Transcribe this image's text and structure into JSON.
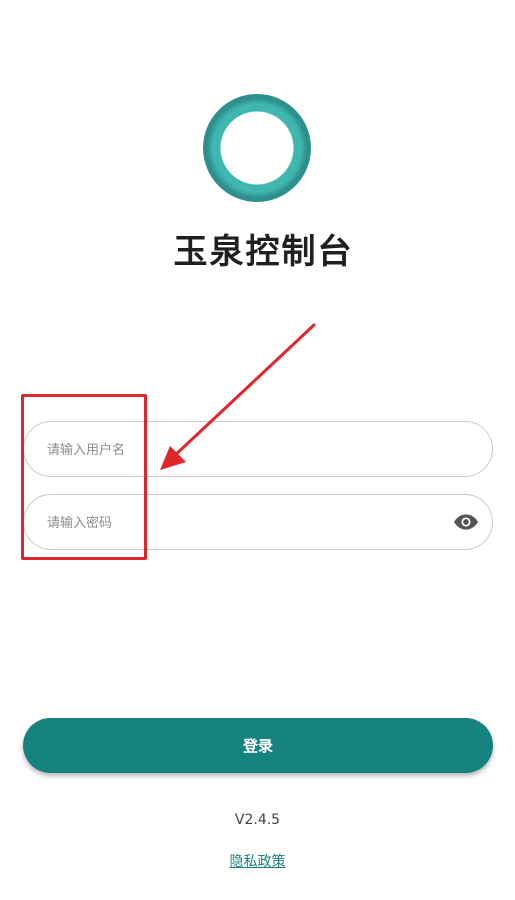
{
  "app": {
    "title": "玉泉控制台",
    "logo_icon": "ring-logo-icon"
  },
  "login_form": {
    "username_placeholder": "请输入用户名",
    "username_value": "",
    "password_placeholder": "请输入密码",
    "password_value": "",
    "toggle_visibility_icon": "eye-icon",
    "submit_label": "登录"
  },
  "footer": {
    "version": "V2.4.5",
    "privacy_link": "隐私政策"
  },
  "colors": {
    "accent": "#15827f",
    "logo_outer": "#2e8f8c",
    "logo_inner": "#3fb6b0",
    "annotation": "#e0262b"
  }
}
